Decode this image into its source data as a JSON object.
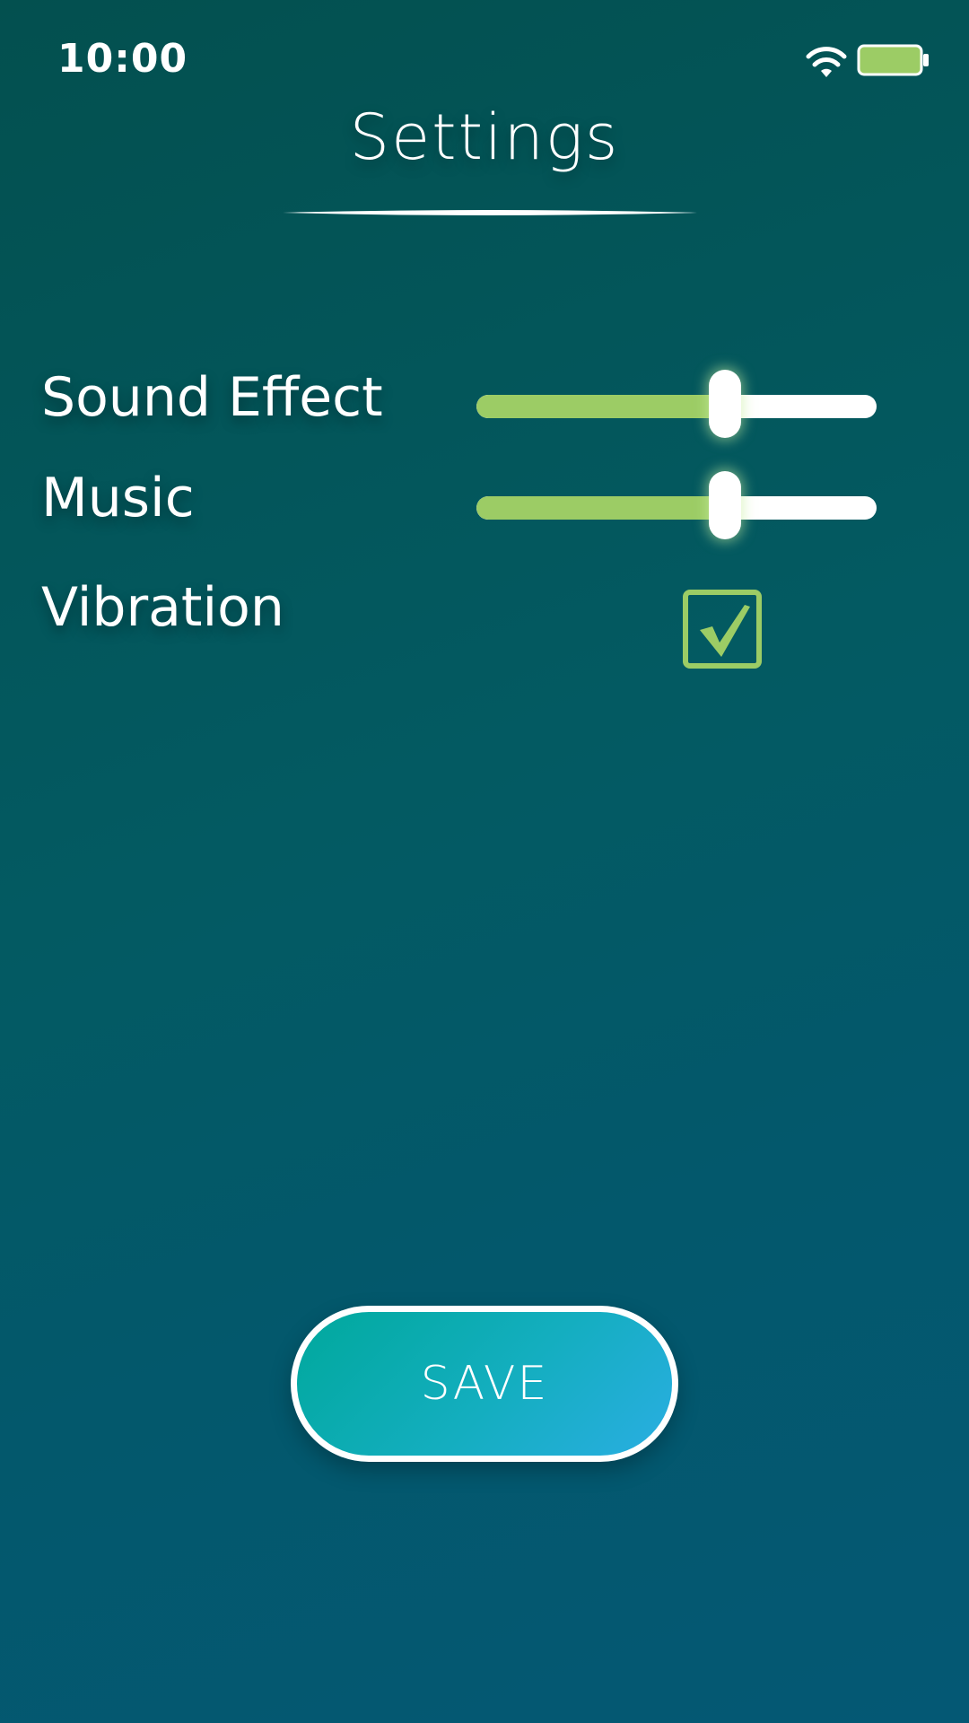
{
  "status_bar": {
    "time": "10:00",
    "icons": [
      "wifi-icon",
      "battery-icon"
    ],
    "battery_color": "#9ccc65"
  },
  "header": {
    "title": "Settings"
  },
  "settings": {
    "sound_effect": {
      "label": "Sound Effect",
      "value_percent": 62
    },
    "music": {
      "label": "Music",
      "value_percent": 62
    },
    "vibration": {
      "label": "Vibration",
      "checked": true
    }
  },
  "actions": {
    "save_label": "SAVE"
  },
  "colors": {
    "accent": "#9ccc65",
    "background_top": "#03504f",
    "background_bottom": "#045874",
    "button_gradient_start": "#00a89c",
    "button_gradient_end": "#2aaee2"
  }
}
